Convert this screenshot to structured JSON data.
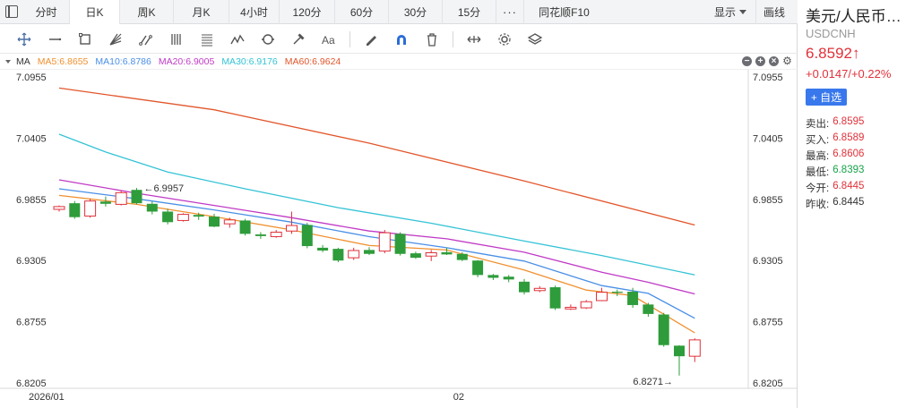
{
  "period_bar": {
    "tabs": [
      {
        "label": "分时",
        "width": 52
      },
      {
        "label": "日K",
        "width": 56,
        "active": true
      },
      {
        "label": "周K",
        "width": 60
      },
      {
        "label": "月K",
        "width": 62
      },
      {
        "label": "4小时",
        "width": 56
      },
      {
        "label": "120分",
        "width": 62
      },
      {
        "label": "60分",
        "width": 60
      },
      {
        "label": "30分",
        "width": 60
      },
      {
        "label": "15分",
        "width": 60
      }
    ],
    "more": "···",
    "f10": "同花顺F10",
    "show_label": "显示",
    "draw_label": "画线"
  },
  "toolbar": {
    "tools": [
      "crosshair-icon",
      "horizontal-line-icon",
      "rectangle-icon",
      "fan-icon",
      "trend-lines-icon",
      "parallel-channel-icon",
      "fibonacci-icon",
      "wave-icon",
      "cycle-icon",
      "hammer-icon",
      "text-icon",
      "eraser-pen-icon",
      "magnet-icon",
      "trash-icon",
      "width-icon",
      "settings-icon",
      "layers-icon"
    ]
  },
  "ma_legend": {
    "label": "MA",
    "items": [
      {
        "text": "MA5:6.8655",
        "color": "#f0902f"
      },
      {
        "text": "MA10:6.8786",
        "color": "#4a8fe6"
      },
      {
        "text": "MA20:6.9005",
        "color": "#c03ac6"
      },
      {
        "text": "MA30:6.9176",
        "color": "#34c3d6"
      },
      {
        "text": "MA60:6.9624",
        "color": "#e2562b"
      }
    ]
  },
  "chart_data": {
    "type": "candlestick",
    "ylim": [
      6.8205,
      7.0955
    ],
    "yticks": [
      "7.0955",
      "7.0405",
      "6.9855",
      "6.9305",
      "6.8755",
      "6.8205"
    ],
    "xlabels": [
      {
        "index": 0,
        "text": "2026/01"
      },
      {
        "index": 26,
        "text": "02"
      }
    ],
    "colors": {
      "up": "#e0313a",
      "down": "#2e9c3a"
    },
    "candles": [
      {
        "o": 6.9765,
        "h": 6.98,
        "l": 6.9745,
        "c": 6.979
      },
      {
        "o": 6.982,
        "h": 6.984,
        "l": 6.968,
        "c": 6.9695
      },
      {
        "o": 6.9705,
        "h": 6.986,
        "l": 6.969,
        "c": 6.984
      },
      {
        "o": 6.9835,
        "h": 6.988,
        "l": 6.979,
        "c": 6.9815
      },
      {
        "o": 6.981,
        "h": 6.9935,
        "l": 6.98,
        "c": 6.9915
      },
      {
        "o": 6.994,
        "h": 6.9957,
        "l": 6.981,
        "c": 6.982
      },
      {
        "o": 6.9815,
        "h": 6.9835,
        "l": 6.972,
        "c": 6.9745
      },
      {
        "o": 6.9745,
        "h": 6.977,
        "l": 6.963,
        "c": 6.965
      },
      {
        "o": 6.9665,
        "h": 6.973,
        "l": 6.9655,
        "c": 6.972
      },
      {
        "o": 6.9715,
        "h": 6.9735,
        "l": 6.967,
        "c": 6.97
      },
      {
        "o": 6.97,
        "h": 6.9725,
        "l": 6.9605,
        "c": 6.961
      },
      {
        "o": 6.9635,
        "h": 6.969,
        "l": 6.96,
        "c": 6.967
      },
      {
        "o": 6.9665,
        "h": 6.968,
        "l": 6.953,
        "c": 6.9545
      },
      {
        "o": 6.954,
        "h": 6.956,
        "l": 6.95,
        "c": 6.9525
      },
      {
        "o": 6.952,
        "h": 6.958,
        "l": 6.951,
        "c": 6.956
      },
      {
        "o": 6.957,
        "h": 6.9745,
        "l": 6.9545,
        "c": 6.962
      },
      {
        "o": 6.9625,
        "h": 6.9645,
        "l": 6.9415,
        "c": 6.9435
      },
      {
        "o": 6.942,
        "h": 6.9445,
        "l": 6.938,
        "c": 6.9395
      },
      {
        "o": 6.941,
        "h": 6.942,
        "l": 6.929,
        "c": 6.9305
      },
      {
        "o": 6.933,
        "h": 6.942,
        "l": 6.931,
        "c": 6.9395
      },
      {
        "o": 6.94,
        "h": 6.9425,
        "l": 6.9355,
        "c": 6.9365
      },
      {
        "o": 6.939,
        "h": 6.958,
        "l": 6.937,
        "c": 6.9555
      },
      {
        "o": 6.9545,
        "h": 6.956,
        "l": 6.935,
        "c": 6.9365
      },
      {
        "o": 6.937,
        "h": 6.9385,
        "l": 6.932,
        "c": 6.933
      },
      {
        "o": 6.9345,
        "h": 6.94,
        "l": 6.93,
        "c": 6.9375
      },
      {
        "o": 6.938,
        "h": 6.942,
        "l": 6.9355,
        "c": 6.936
      },
      {
        "o": 6.9365,
        "h": 6.938,
        "l": 6.93,
        "c": 6.931
      },
      {
        "o": 6.9305,
        "h": 6.931,
        "l": 6.9155,
        "c": 6.9175
      },
      {
        "o": 6.9175,
        "h": 6.9185,
        "l": 6.913,
        "c": 6.915
      },
      {
        "o": 6.916,
        "h": 6.9175,
        "l": 6.911,
        "c": 6.9135
      },
      {
        "o": 6.9115,
        "h": 6.914,
        "l": 6.9,
        "c": 6.902
      },
      {
        "o": 6.9035,
        "h": 6.9075,
        "l": 6.902,
        "c": 6.9055
      },
      {
        "o": 6.9065,
        "h": 6.908,
        "l": 6.886,
        "c": 6.8875
      },
      {
        "o": 6.887,
        "h": 6.891,
        "l": 6.886,
        "c": 6.8885
      },
      {
        "o": 6.888,
        "h": 6.895,
        "l": 6.887,
        "c": 6.8935
      },
      {
        "o": 6.8945,
        "h": 6.906,
        "l": 6.894,
        "c": 6.902
      },
      {
        "o": 6.9025,
        "h": 6.9045,
        "l": 6.8985,
        "c": 6.9015
      },
      {
        "o": 6.9025,
        "h": 6.906,
        "l": 6.888,
        "c": 6.8905
      },
      {
        "o": 6.891,
        "h": 6.8925,
        "l": 6.88,
        "c": 6.8825
      },
      {
        "o": 6.882,
        "h": 6.8835,
        "l": 6.853,
        "c": 6.8545
      },
      {
        "o": 6.854,
        "h": 6.8545,
        "l": 6.8271,
        "c": 6.8445
      },
      {
        "o": 6.8445,
        "h": 6.8606,
        "l": 6.8393,
        "c": 6.8592
      }
    ],
    "ma_lines": [
      {
        "name": "MA5",
        "color": "#f0902f",
        "points": [
          [
            0,
            6.989
          ],
          [
            5,
            6.981
          ],
          [
            10,
            6.97
          ],
          [
            15,
            6.958
          ],
          [
            20,
            6.944
          ],
          [
            25,
            6.94
          ],
          [
            30,
            6.922
          ],
          [
            34,
            6.904
          ],
          [
            37,
            6.899
          ],
          [
            41,
            6.8655
          ]
        ]
      },
      {
        "name": "MA10",
        "color": "#4a8fe6",
        "points": [
          [
            0,
            6.995
          ],
          [
            5,
            6.986
          ],
          [
            10,
            6.976
          ],
          [
            15,
            6.965
          ],
          [
            20,
            6.952
          ],
          [
            25,
            6.942
          ],
          [
            30,
            6.93
          ],
          [
            35,
            6.908
          ],
          [
            38,
            6.901
          ],
          [
            41,
            6.8786
          ]
        ]
      },
      {
        "name": "MA20",
        "color": "#c03ac6",
        "points": [
          [
            0,
            7.003
          ],
          [
            5,
            6.991
          ],
          [
            10,
            6.98
          ],
          [
            15,
            6.969
          ],
          [
            20,
            6.957
          ],
          [
            25,
            6.95
          ],
          [
            30,
            6.938
          ],
          [
            35,
            6.92
          ],
          [
            38,
            6.911
          ],
          [
            41,
            6.9005
          ]
        ]
      },
      {
        "name": "MA30",
        "color": "#34c3d6",
        "points": [
          [
            0,
            7.044
          ],
          [
            3,
            7.028
          ],
          [
            7,
            7.01
          ],
          [
            12,
            6.995
          ],
          [
            18,
            6.978
          ],
          [
            24,
            6.964
          ],
          [
            30,
            6.948
          ],
          [
            35,
            6.935
          ],
          [
            41,
            6.9176
          ]
        ]
      },
      {
        "name": "MA60",
        "color": "#e2562b",
        "points": [
          [
            0,
            7.0855
          ],
          [
            10,
            7.066
          ],
          [
            20,
            7.036
          ],
          [
            30,
            7.002
          ],
          [
            41,
            6.9624
          ]
        ]
      }
    ],
    "annotations": [
      {
        "index": 5,
        "value": 6.9957,
        "text": "←6.9957",
        "side": "right"
      },
      {
        "index": 40,
        "value": 6.8271,
        "text": "6.8271→",
        "side": "left"
      }
    ]
  },
  "quote": {
    "title": "美元/人民币…",
    "code": "USDCNH",
    "price": "6.8592↑",
    "change": "+0.0147/+0.22%",
    "watch_label": "+ 自选",
    "rows": [
      {
        "label": "卖出:",
        "value": "6.8595",
        "tone": "red"
      },
      {
        "label": "买入:",
        "value": "6.8589",
        "tone": "red"
      },
      {
        "label": "最高:",
        "value": "6.8606",
        "tone": "red"
      },
      {
        "label": "最低:",
        "value": "6.8393",
        "tone": "green"
      },
      {
        "label": "今开:",
        "value": "6.8445",
        "tone": "red"
      },
      {
        "label": "昨收:",
        "value": "6.8445",
        "tone": "dark"
      }
    ]
  }
}
